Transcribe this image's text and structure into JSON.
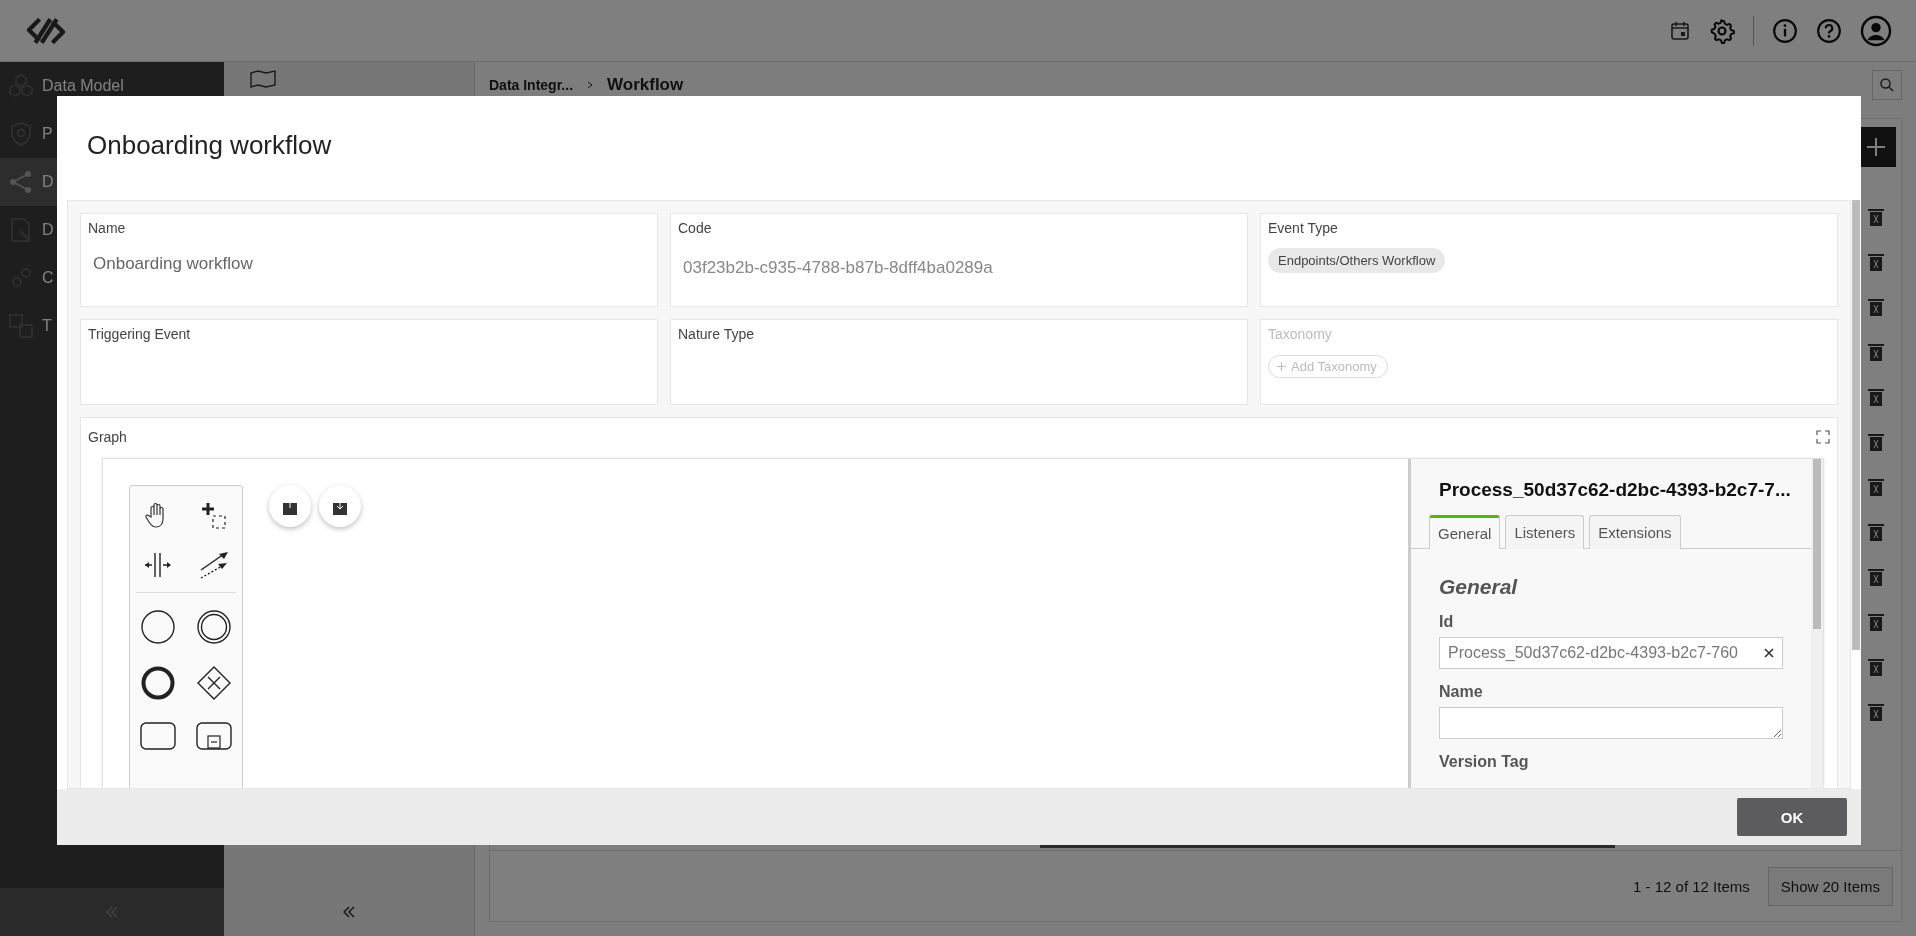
{
  "sidebar": {
    "items": [
      {
        "label": "Data Model",
        "selected": false
      },
      {
        "label": "P",
        "selected": false
      },
      {
        "label": "D",
        "selected": true
      },
      {
        "label": "D",
        "selected": false
      },
      {
        "label": "C",
        "selected": false
      },
      {
        "label": "T",
        "selected": false
      }
    ]
  },
  "breadcrumb": {
    "parent": "Data Integr...",
    "current": "Workflow"
  },
  "pager": {
    "summary": "1 - 12 of 12 Items",
    "page_size_button": "Show 20 Items"
  },
  "dialog": {
    "title": "Onboarding workflow",
    "fields": [
      {
        "label": "Name",
        "kind": "text",
        "value": "Onboarding workflow",
        "disabled": false
      },
      {
        "label": "Code",
        "kind": "text",
        "value": "03f23b2b-c935-4788-b87b-8dff4ba0289a",
        "disabled": false
      },
      {
        "label": "Event Type",
        "kind": "chip",
        "value": "Endpoints/Others Workflow",
        "disabled": false
      },
      {
        "label": "Triggering Event",
        "kind": "empty",
        "disabled": false
      },
      {
        "label": "Nature Type",
        "kind": "empty",
        "disabled": false
      },
      {
        "label": "Taxonomy",
        "kind": "add",
        "value": "Add Taxonomy",
        "disabled": true
      }
    ],
    "graph": {
      "label": "Graph",
      "properties": {
        "title": "Process_50d37c62-d2bc-4393-b2c7-7...",
        "tabs": [
          {
            "label": "General",
            "selected": true
          },
          {
            "label": "Listeners",
            "selected": false
          },
          {
            "label": "Extensions",
            "selected": false
          }
        ],
        "section": "General",
        "id_label": "Id",
        "id_value": "Process_50d37c62-d2bc-4393-b2c7-760",
        "name_label": "Name",
        "version_label": "Version Tag"
      }
    },
    "ok_button": "OK"
  }
}
